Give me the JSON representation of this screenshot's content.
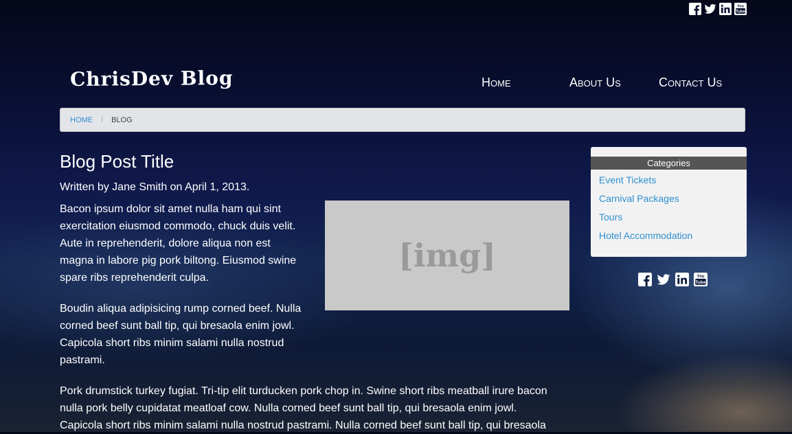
{
  "social": {
    "icons": [
      "facebook-icon",
      "twitter-icon",
      "linkedin-icon",
      "youtube-icon"
    ]
  },
  "header": {
    "logo": "ChrisDev Blog",
    "nav": [
      "Home",
      "About Us",
      "Contact Us"
    ]
  },
  "breadcrumb": {
    "home": "HOME",
    "separator": "/",
    "current": "BLOG"
  },
  "post": {
    "title": "Blog Post Title",
    "byline": "Written by Jane Smith on April 1, 2013.",
    "image_placeholder": "[img]",
    "paragraphs": [
      "Bacon ipsum dolor sit amet nulla ham qui sint exercitation eiusmod commodo, chuck duis velit. Aute in reprehenderit, dolore aliqua non est magna in labore pig pork biltong. Eiusmod swine spare ribs reprehenderit culpa.",
      "Boudin aliqua adipisicing rump corned beef. Nulla corned beef sunt ball tip, qui bresaola enim jowl. Capicola short ribs minim salami nulla nostrud pastrami.",
      "Pork drumstick turkey fugiat. Tri-tip elit turducken pork chop in. Swine short ribs meatball irure bacon nulla pork belly cupidatat meatloaf cow. Nulla corned beef sunt ball tip, qui bresaola enim jowl. Capicola short ribs minim salami nulla nostrud pastrami. Nulla corned beef sunt ball tip, qui bresaola"
    ]
  },
  "sidebar": {
    "heading": "Categories",
    "items": [
      "Event Tickets",
      "Carnival Packages",
      "Tours",
      "Hotel Accommodation"
    ]
  },
  "colors": {
    "link": "#2f8fd0",
    "breadcrumb_bg": "#e2e4e8",
    "sidebar_bg": "#f2f2f2",
    "category_header": "#555555"
  }
}
